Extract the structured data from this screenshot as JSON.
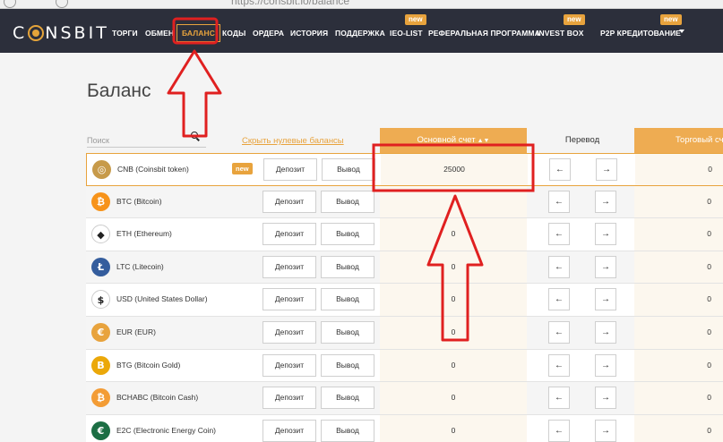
{
  "browser": {
    "url": "https://consbit.io/balance"
  },
  "nav": {
    "logo": "CONSBIT",
    "items": [
      {
        "label": "ТОРГИ"
      },
      {
        "label": "ОБМЕН"
      },
      {
        "label": "БАЛАНС",
        "active": true
      },
      {
        "label": "КОДЫ"
      },
      {
        "label": "ОРДЕРА"
      },
      {
        "label": "ИСТОРИЯ"
      },
      {
        "label": "ПОДДЕРЖКА"
      },
      {
        "label": "IEO-LIST",
        "badge": "new"
      },
      {
        "label": "РЕФЕРАЛЬНАЯ ПРОГРАММА"
      },
      {
        "label": "INVEST BOX",
        "badge": "new"
      },
      {
        "label": "P2P КРЕДИТОВАНИЕ",
        "badge": "new"
      }
    ]
  },
  "page": {
    "title": "Баланс",
    "search_placeholder": "Поиск",
    "hide_zero": "Скрыть нулевые балансы",
    "col_main": "Основной счет",
    "col_transfer": "Перевод",
    "col_trade": "Торговый счет"
  },
  "colors": {
    "accent": "#e8a33d",
    "nav_bg": "#2c2f3b",
    "annotation": "#e02020"
  },
  "buttons": {
    "deposit": "Депозит",
    "withdraw": "Вывод",
    "left_arrow": "←",
    "right_arrow": "→"
  },
  "rows": [
    {
      "name": "CNB (Coinsbit token)",
      "icon": "cnb-icon",
      "icon_color": "#c79a4a",
      "symbol": "◎",
      "badge": "new",
      "main": "25000",
      "trade": "0"
    },
    {
      "name": "BTC (Bitcoin)",
      "icon": "btc-icon",
      "icon_color": "#f7931a",
      "symbol": "₿",
      "main": "",
      "trade": "0"
    },
    {
      "name": "ETH (Ethereum)",
      "icon": "eth-icon",
      "icon_color": "#ffffff",
      "symbol": "◆",
      "main": "0",
      "trade": "0"
    },
    {
      "name": "LTC (Litecoin)",
      "icon": "ltc-icon",
      "icon_color": "#345d9d",
      "symbol": "Ł",
      "main": "0",
      "trade": "0"
    },
    {
      "name": "USD (United States Dollar)",
      "icon": "usd-icon",
      "icon_color": "#ffffff",
      "symbol": "$",
      "main": "0",
      "trade": "0"
    },
    {
      "name": "EUR (EUR)",
      "icon": "eur-icon",
      "icon_color": "#e8a33d",
      "symbol": "€",
      "main": "0",
      "trade": "0"
    },
    {
      "name": "BTG (Bitcoin Gold)",
      "icon": "btg-icon",
      "icon_color": "#eba809",
      "symbol": "B",
      "main": "0",
      "trade": "0"
    },
    {
      "name": "BCHABC (Bitcoin Cash)",
      "icon": "bch-icon",
      "icon_color": "#f39c35",
      "symbol": "₿",
      "main": "0",
      "trade": "0"
    },
    {
      "name": "E2C (Electronic Energy Coin)",
      "icon": "e2c-icon",
      "icon_color": "#1c6e44",
      "symbol": "€",
      "main": "0",
      "trade": "0"
    }
  ]
}
